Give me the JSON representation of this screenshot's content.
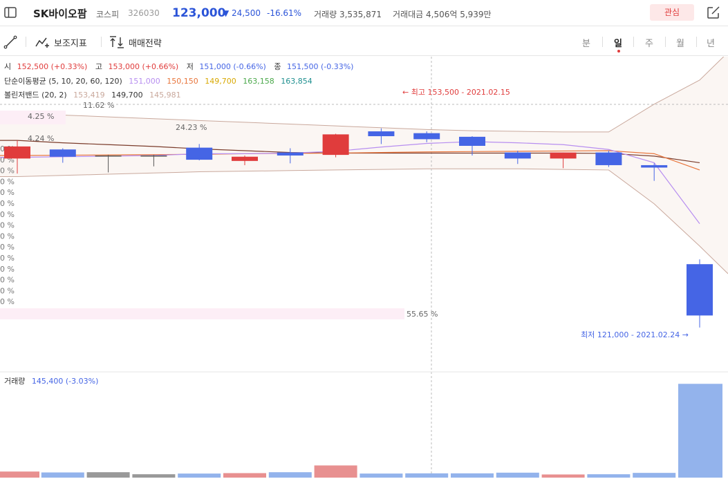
{
  "header": {
    "title": "SK바이오팜",
    "market": "코스피",
    "code": "326030",
    "price": "123,000",
    "change": "24,500",
    "change_pct": "-16.61%",
    "volume_label": "거래량",
    "volume": "3,535,871",
    "amount_label": "거래대금",
    "amount": "4,506억 5,939만",
    "favorite_label": "관심"
  },
  "toolbar": {
    "indicator_label": "보조지표",
    "strategy_label": "매매전략",
    "timeframes": [
      "분",
      "일",
      "주",
      "월",
      "년"
    ],
    "active_timeframe": "일"
  },
  "ohlc": {
    "open_label": "시",
    "open": "152,500 (+0.33%)",
    "high_label": "고",
    "high": "153,000 (+0.66%)",
    "low_label": "저",
    "low": "151,000 (-0.66%)",
    "close_label": "종",
    "close": "151,500 (-0.33%)"
  },
  "ma_legend": {
    "label": "단순이동평균 (5, 10, 20, 60, 120)",
    "values": [
      "151,000",
      "150,150",
      "149,700",
      "163,158",
      "163,854"
    ]
  },
  "bb_legend": {
    "label": "볼린저밴드 (20, 2)",
    "values": [
      "153,419",
      "149,700",
      "145,981"
    ]
  },
  "annotations": {
    "high": "← 최고 153,500 - 2021.02.15",
    "low": "최저 121,000 - 2021.02.24 →"
  },
  "volume_legend": {
    "label": "거래량",
    "value": "145,400 (-3.03%)"
  },
  "overlay_labels": {
    "l1": "4.25 %",
    "l2": "11.62 %",
    "l3": "4.24 %",
    "l4": "24.23 %",
    "l5": "55.65 %",
    "edge": "0 %"
  },
  "colors": {
    "up": "#e03c3c",
    "down": "#4565e5",
    "flat": "#555555",
    "ma5": "#b78ef0",
    "ma10": "#e8743a",
    "ma20": "#7a3b2a",
    "bb": "#c9a89c",
    "vol_up": "#e89090",
    "vol_down": "#93b3ec",
    "vol_flat": "#999999"
  },
  "chart_data": {
    "type": "candlestick",
    "candles": [
      {
        "o": 151000,
        "h": 152000,
        "l": 146500,
        "c": 149000,
        "dir": "up"
      },
      {
        "o": 150500,
        "h": 150700,
        "l": 148300,
        "c": 149300,
        "dir": "down"
      },
      {
        "o": 149500,
        "h": 149600,
        "l": 146700,
        "c": 149500,
        "dir": "flat"
      },
      {
        "o": 149500,
        "h": 149600,
        "l": 147700,
        "c": 149500,
        "dir": "flat"
      },
      {
        "o": 150800,
        "h": 151400,
        "l": 148700,
        "c": 148800,
        "dir": "down"
      },
      {
        "o": 149300,
        "h": 149500,
        "l": 147900,
        "c": 148600,
        "dir": "up"
      },
      {
        "o": 150000,
        "h": 150700,
        "l": 148200,
        "c": 149500,
        "dir": "down"
      },
      {
        "o": 149600,
        "h": 153100,
        "l": 149200,
        "c": 153000,
        "dir": "up"
      },
      {
        "o": 153500,
        "h": 154000,
        "l": 151400,
        "c": 152700,
        "dir": "down"
      },
      {
        "o": 153200,
        "h": 153500,
        "l": 151700,
        "c": 152200,
        "dir": "down"
      },
      {
        "o": 152600,
        "h": 152700,
        "l": 149500,
        "c": 151100,
        "dir": "down"
      },
      {
        "o": 150000,
        "h": 150300,
        "l": 148100,
        "c": 149000,
        "dir": "down"
      },
      {
        "o": 149000,
        "h": 150000,
        "l": 147400,
        "c": 150000,
        "dir": "up"
      },
      {
        "o": 150000,
        "h": 150300,
        "l": 147600,
        "c": 147900,
        "dir": "down"
      },
      {
        "o": 147900,
        "h": 148200,
        "l": 145300,
        "c": 147500,
        "dir": "down"
      },
      {
        "o": 131500,
        "h": 132300,
        "l": 121000,
        "c": 123000,
        "dir": "down"
      }
    ],
    "ma5": [
      149200,
      149300,
      149400,
      149500,
      149800,
      149800,
      149900,
      150200,
      150900,
      151500,
      151800,
      151600,
      151300,
      150500,
      148300,
      138200
    ],
    "ma10": [
      149500,
      149550,
      149600,
      149650,
      149700,
      149800,
      149850,
      149900,
      150000,
      150100,
      150150,
      150200,
      150250,
      150300,
      149800,
      147100
    ],
    "ma20": [
      152000,
      151600,
      151300,
      151000,
      150600,
      150300,
      150000,
      149900,
      149900,
      149900,
      149900,
      149900,
      149900,
      149850,
      149400,
      148300
    ],
    "bb_upper": [
      156500,
      156200,
      155900,
      155600,
      155300,
      155000,
      154700,
      154400,
      154100,
      153800,
      153600,
      153500,
      153400,
      153400,
      158000,
      162000
    ],
    "bb_lower": [
      146000,
      146200,
      146400,
      146600,
      146800,
      146900,
      147000,
      147100,
      147200,
      147300,
      147300,
      147300,
      147200,
      147100,
      141500,
      134500
    ],
    "volume": [
      1350,
      1150,
      1200,
      750,
      900,
      1000,
      1200,
      2700,
      900,
      950,
      950,
      1100,
      700,
      750,
      1050,
      20800
    ],
    "vol_dir": [
      "up",
      "down",
      "flat",
      "flat",
      "down",
      "up",
      "down",
      "up",
      "down",
      "down",
      "down",
      "down",
      "up",
      "down",
      "down",
      "down"
    ],
    "y_range": [
      119500,
      159000
    ],
    "vol_max": 21000
  }
}
